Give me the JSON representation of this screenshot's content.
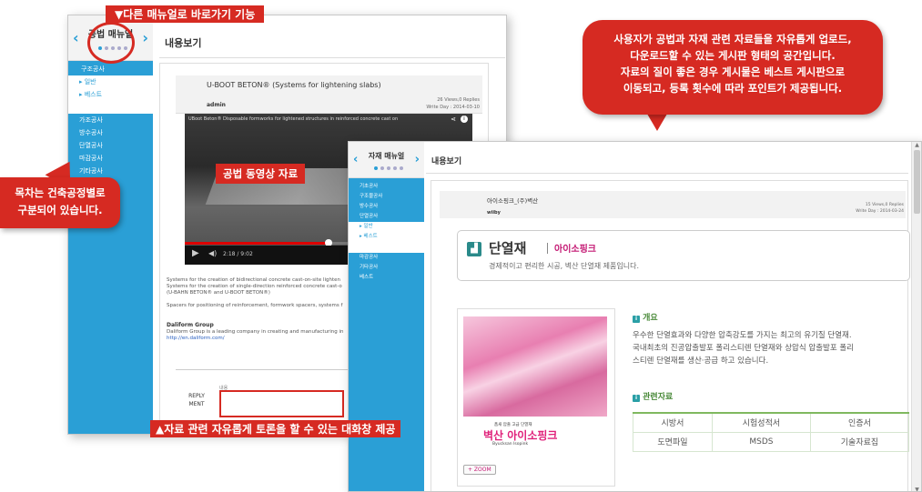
{
  "callouts": {
    "top_label": "▼다른 매뉴얼로 바로가기 기능",
    "bubble_right": [
      "사용자가 공법과 자재 관련 자료들을 자유롭게 업로드,",
      "다운로드할 수 있는 게시판 형태의 공간입니다.",
      "자료의 질이 좋은 경우 게시물은 베스트 게시판으로",
      "이동되고, 등록 횟수에 따라 포인트가 제공됩니다."
    ],
    "bubble_left": [
      "목차는 건축공정별로",
      "구분되어 있습니다."
    ],
    "video_label": "공법 동영상 자료",
    "bottom_label": "▲자료 관련 자유롭게 토론을 할 수 있는 대화창 제공"
  },
  "window1": {
    "side_title": "공법 매뉴얼",
    "arrow_left": "‹",
    "arrow_right": "›",
    "menu": [
      "구조공사",
      "▸ 일반",
      "▸ 베스트",
      "가조공사",
      "방수공사",
      "단열공사",
      "마감공사",
      "기타공사"
    ],
    "content_title": "내용보기",
    "post_title": "U-BOOT BETON® (Systems for lightening slabs)",
    "author": "admin",
    "stats": "26 Views,0 Replies",
    "date": "Write Day : 2014-03-10",
    "video_caption": "UBoot Beton® Disposable formworks for lightened structures in reinforced concrete cast on",
    "video_time": "2:18 / 9:02",
    "body": [
      "Systems for the creation of bidirectional concrete cast-on-site lighten",
      "Systems for the creation of single-direction reinforced concrete cast-o",
      "(U-BAHN BETON® and U-BOOT BETON®)",
      "",
      "Spacers for positioning of reinforcement, formwork spacers, systems f"
    ],
    "company_name": "Daliform Group",
    "company_desc": "Daliform Group is a leading company in creating and manufacturing in",
    "company_url": "http://en.daliform.com/",
    "reply_label": "REPLY MENT",
    "reply_field_label": "내용"
  },
  "window2": {
    "side_title": "자재 매뉴얼",
    "arrow_left": "‹",
    "arrow_right": "›",
    "menu": [
      "기초공사",
      "구조물공사",
      "방수공사",
      "단열공사",
      "▸ 일반",
      "▸ 베스트",
      "마감공사",
      "기타공사",
      "베스트"
    ],
    "content_title": "내용보기",
    "post_title": "아이소핑크_(주)벽산",
    "author": "wiiby",
    "stats": "15 Views,0 Replies",
    "date": "Write Day : 2014-03-24",
    "banner_title": "단열재",
    "banner_brand": "아이소핑크",
    "banner_sub": "경제적이고 편리한 시공, 벽산 단열재 제품입니다.",
    "product_logo": "벽산 아이소핑크",
    "product_small": "품새 압출 고급 단열재",
    "product_en": "Byucksan Isopink",
    "zoom": "+ ZOOM",
    "section1": "개요",
    "overview": [
      "우수한 단열효과와 다양한 압축강도를 가지는 최고의 유기질 단열재.",
      "국내최초의 진공압출발포 폴리스티렌 단열재와 상압식 압출발포 폴리",
      "스티렌 단열재를 생산·공급 하고 있습니다."
    ],
    "section2": "관련자료",
    "table": [
      [
        "시방서",
        "시험성적서",
        "인증서"
      ],
      [
        "도면파일",
        "MSDS",
        "기술자료집"
      ]
    ]
  },
  "colors": {
    "accent": "#2a9fd6",
    "red": "#d62a22"
  }
}
